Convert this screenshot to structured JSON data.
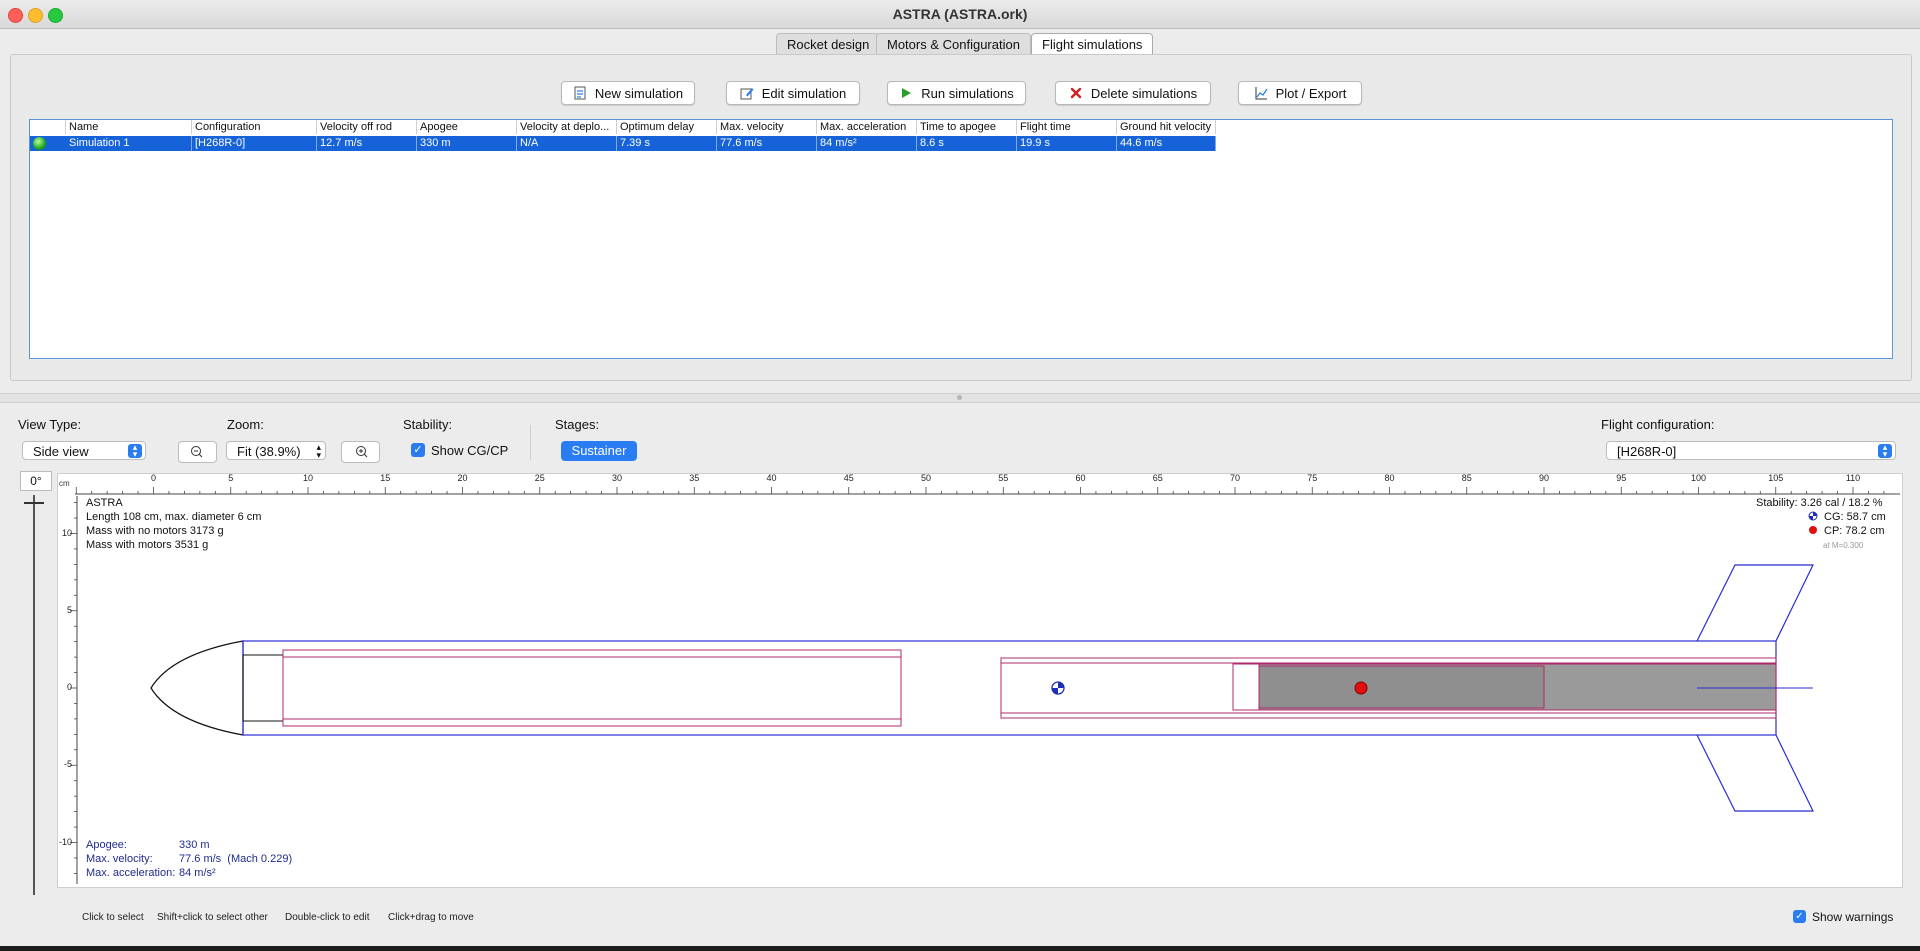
{
  "window": {
    "title": "ASTRA (ASTRA.ork)"
  },
  "tabs": [
    "Rocket design",
    "Motors & Configuration",
    "Flight simulations"
  ],
  "toolbar": {
    "new_sim": "New simulation",
    "edit_sim": "Edit simulation",
    "run_sim": "Run simulations",
    "delete_sim": "Delete simulations",
    "plot_export": "Plot / Export"
  },
  "table": {
    "headers": [
      "Name",
      "Configuration",
      "Velocity off rod",
      "Apogee",
      "Velocity at deplo...",
      "Optimum delay",
      "Max. velocity",
      "Max. acceleration",
      "Time to apogee",
      "Flight time",
      "Ground hit velocity"
    ],
    "rows": [
      [
        "Simulation 1",
        "[H268R-0]",
        "12.7 m/s",
        "330 m",
        "N/A",
        "7.39 s",
        "77.6 m/s",
        "84 m/s²",
        "8.6 s",
        "19.9 s",
        "44.6 m/s"
      ]
    ]
  },
  "controls": {
    "view_type_label": "View Type:",
    "view_type_value": "Side view",
    "zoom_label": "Zoom:",
    "zoom_value": "Fit (38.9%)",
    "stability_label": "Stability:",
    "show_cgcp": "Show CG/CP",
    "stages_label": "Stages:",
    "stage_button": "Sustainer",
    "flight_config_label": "Flight configuration:",
    "flight_config_value": "[H268R-0]"
  },
  "view": {
    "rotation": "0°",
    "ruler_unit": "cm",
    "ruler_x": [
      "0",
      "5",
      "10",
      "15",
      "20",
      "25",
      "30",
      "35",
      "40",
      "45",
      "50",
      "55",
      "60",
      "65",
      "70",
      "75",
      "80",
      "85",
      "90",
      "95",
      "100",
      "105",
      "110"
    ],
    "ruler_y": [
      "10",
      "5",
      "0",
      "-5",
      "-10"
    ],
    "rocket_name": "ASTRA",
    "length_info": "Length 108 cm, max. diameter 6 cm",
    "mass_no_motors": "Mass with no motors 3173 g",
    "mass_with_motors": "Mass with motors 3531 g",
    "stability": "Stability: 3.26 cal / 18.2 %",
    "cg": "CG: 58.7 cm",
    "cp": "CP: 78.2 cm",
    "mach": "at M=0.300",
    "apogee_label": "Apogee:",
    "apogee_value": "330 m",
    "maxvel_label": "Max. velocity:",
    "maxvel_value": "77.6 m/s  (Mach 0.229)",
    "maxacc_label": "Max. acceleration:",
    "maxacc_value": "84 m/s²"
  },
  "hints": [
    "Click to select",
    "Shift+click to select other",
    "Double-click to edit",
    "Click+drag to move"
  ],
  "show_warnings": "Show warnings",
  "colors": {
    "selection": "#1662d8",
    "accent": "#2a7cf3",
    "body_outline": "#2b2bd6",
    "inner_outline": "#b0286a"
  }
}
